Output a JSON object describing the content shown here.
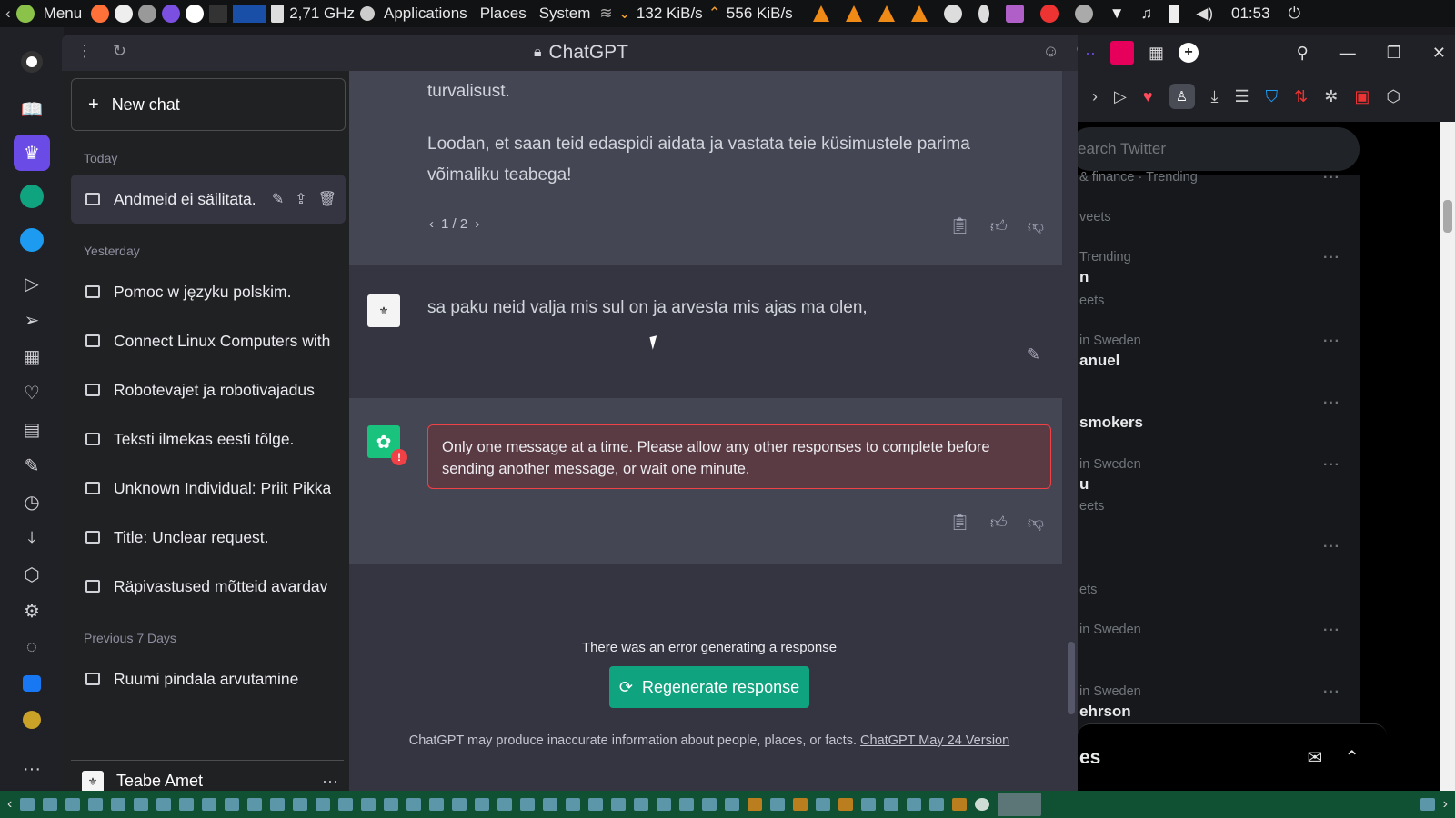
{
  "system_bar": {
    "menu": "Menu",
    "cpu": "2,71 GHz",
    "applications": "Applications",
    "places": "Places",
    "system": "System",
    "down": "132 KiB/s",
    "up": "556 KiB/s",
    "clock": "01:53"
  },
  "window": {
    "title": "ChatGPT"
  },
  "sidebar": {
    "new_chat": "New chat",
    "today": "Today",
    "yesterday": "Yesterday",
    "previous": "Previous 7 Days",
    "items_today": [
      "Andmeid ei säilitata."
    ],
    "items_yesterday": [
      "Pomoc w języku polskim.",
      "Connect Linux Computers with",
      "Robotevajet ja robotivajadus",
      "Teksti ilmekas eesti tõlge.",
      "Unknown Individual: Priit Pikka",
      "Title: Unclear request.",
      "Räpivastused mõtteid avardav"
    ],
    "items_previous": [
      "Ruumi pindala arvutamine"
    ],
    "user_name": "Teabe Amet"
  },
  "conversation": {
    "assistant_text_1": "turvalisust.",
    "assistant_text_2": "Loodan, et saan teid edaspidi aidata ja vastata teie küsimustele parima võimaliku teabega!",
    "pager": "1 / 2",
    "user_message": "sa paku neid valja mis sul on ja arvesta mis ajas ma olen,",
    "error_message": "Only one message at a time. Please allow any other responses to complete before sending another message, or wait one minute.",
    "error_generating": "There was an error generating a response",
    "regenerate": "Regenerate response",
    "disclaimer": "ChatGPT may produce inaccurate information about people, places, or facts.",
    "version_link": "ChatGPT May 24 Version"
  },
  "twitter": {
    "search_placeholder": "earch Twitter",
    "trend_1": "& finance · Trending",
    "trend_1b": "veets",
    "trend_2": "Trending",
    "trend_2a": "n",
    "trend_2b": "eets",
    "trend_3": "in Sweden",
    "trend_3b": "anuel",
    "trend_4b": "smokers",
    "trend_5": "in Sweden",
    "trend_5a": "u",
    "trend_5b": "eets",
    "trend_6b": "ets",
    "trend_7": "in Sweden",
    "trend_8": "in Sweden",
    "trend_8b": "ehrson",
    "messages": "es"
  }
}
